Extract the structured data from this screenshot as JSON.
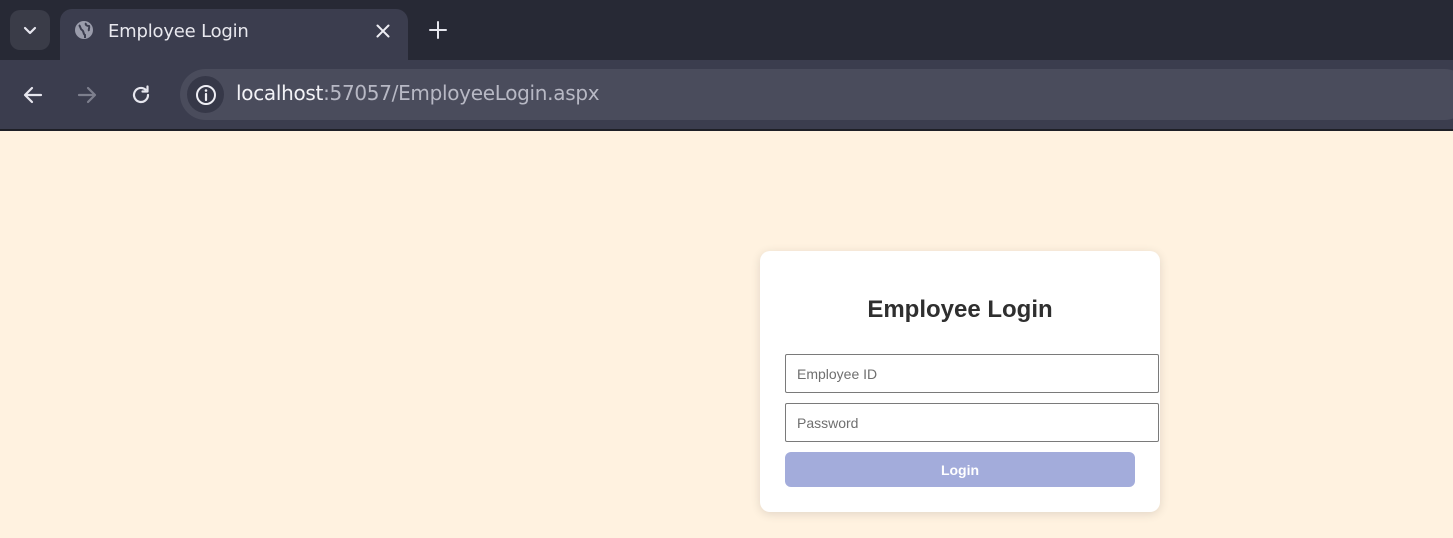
{
  "browser": {
    "tab": {
      "title": "Employee Login",
      "favicon": "globe-icon"
    },
    "address_bar": {
      "host": "localhost",
      "rest": ":57057/EmployeeLogin.aspx"
    }
  },
  "login": {
    "title": "Employee Login",
    "employee_id": {
      "placeholder": "Employee ID",
      "value": ""
    },
    "password": {
      "placeholder": "Password",
      "value": ""
    },
    "button_label": "Login"
  },
  "colors": {
    "page_background": "#fff2e0",
    "card_background": "#ffffff",
    "button_background": "#a3acdb",
    "chrome_dark": "#272935",
    "chrome_toolbar": "#3b3d4e"
  }
}
